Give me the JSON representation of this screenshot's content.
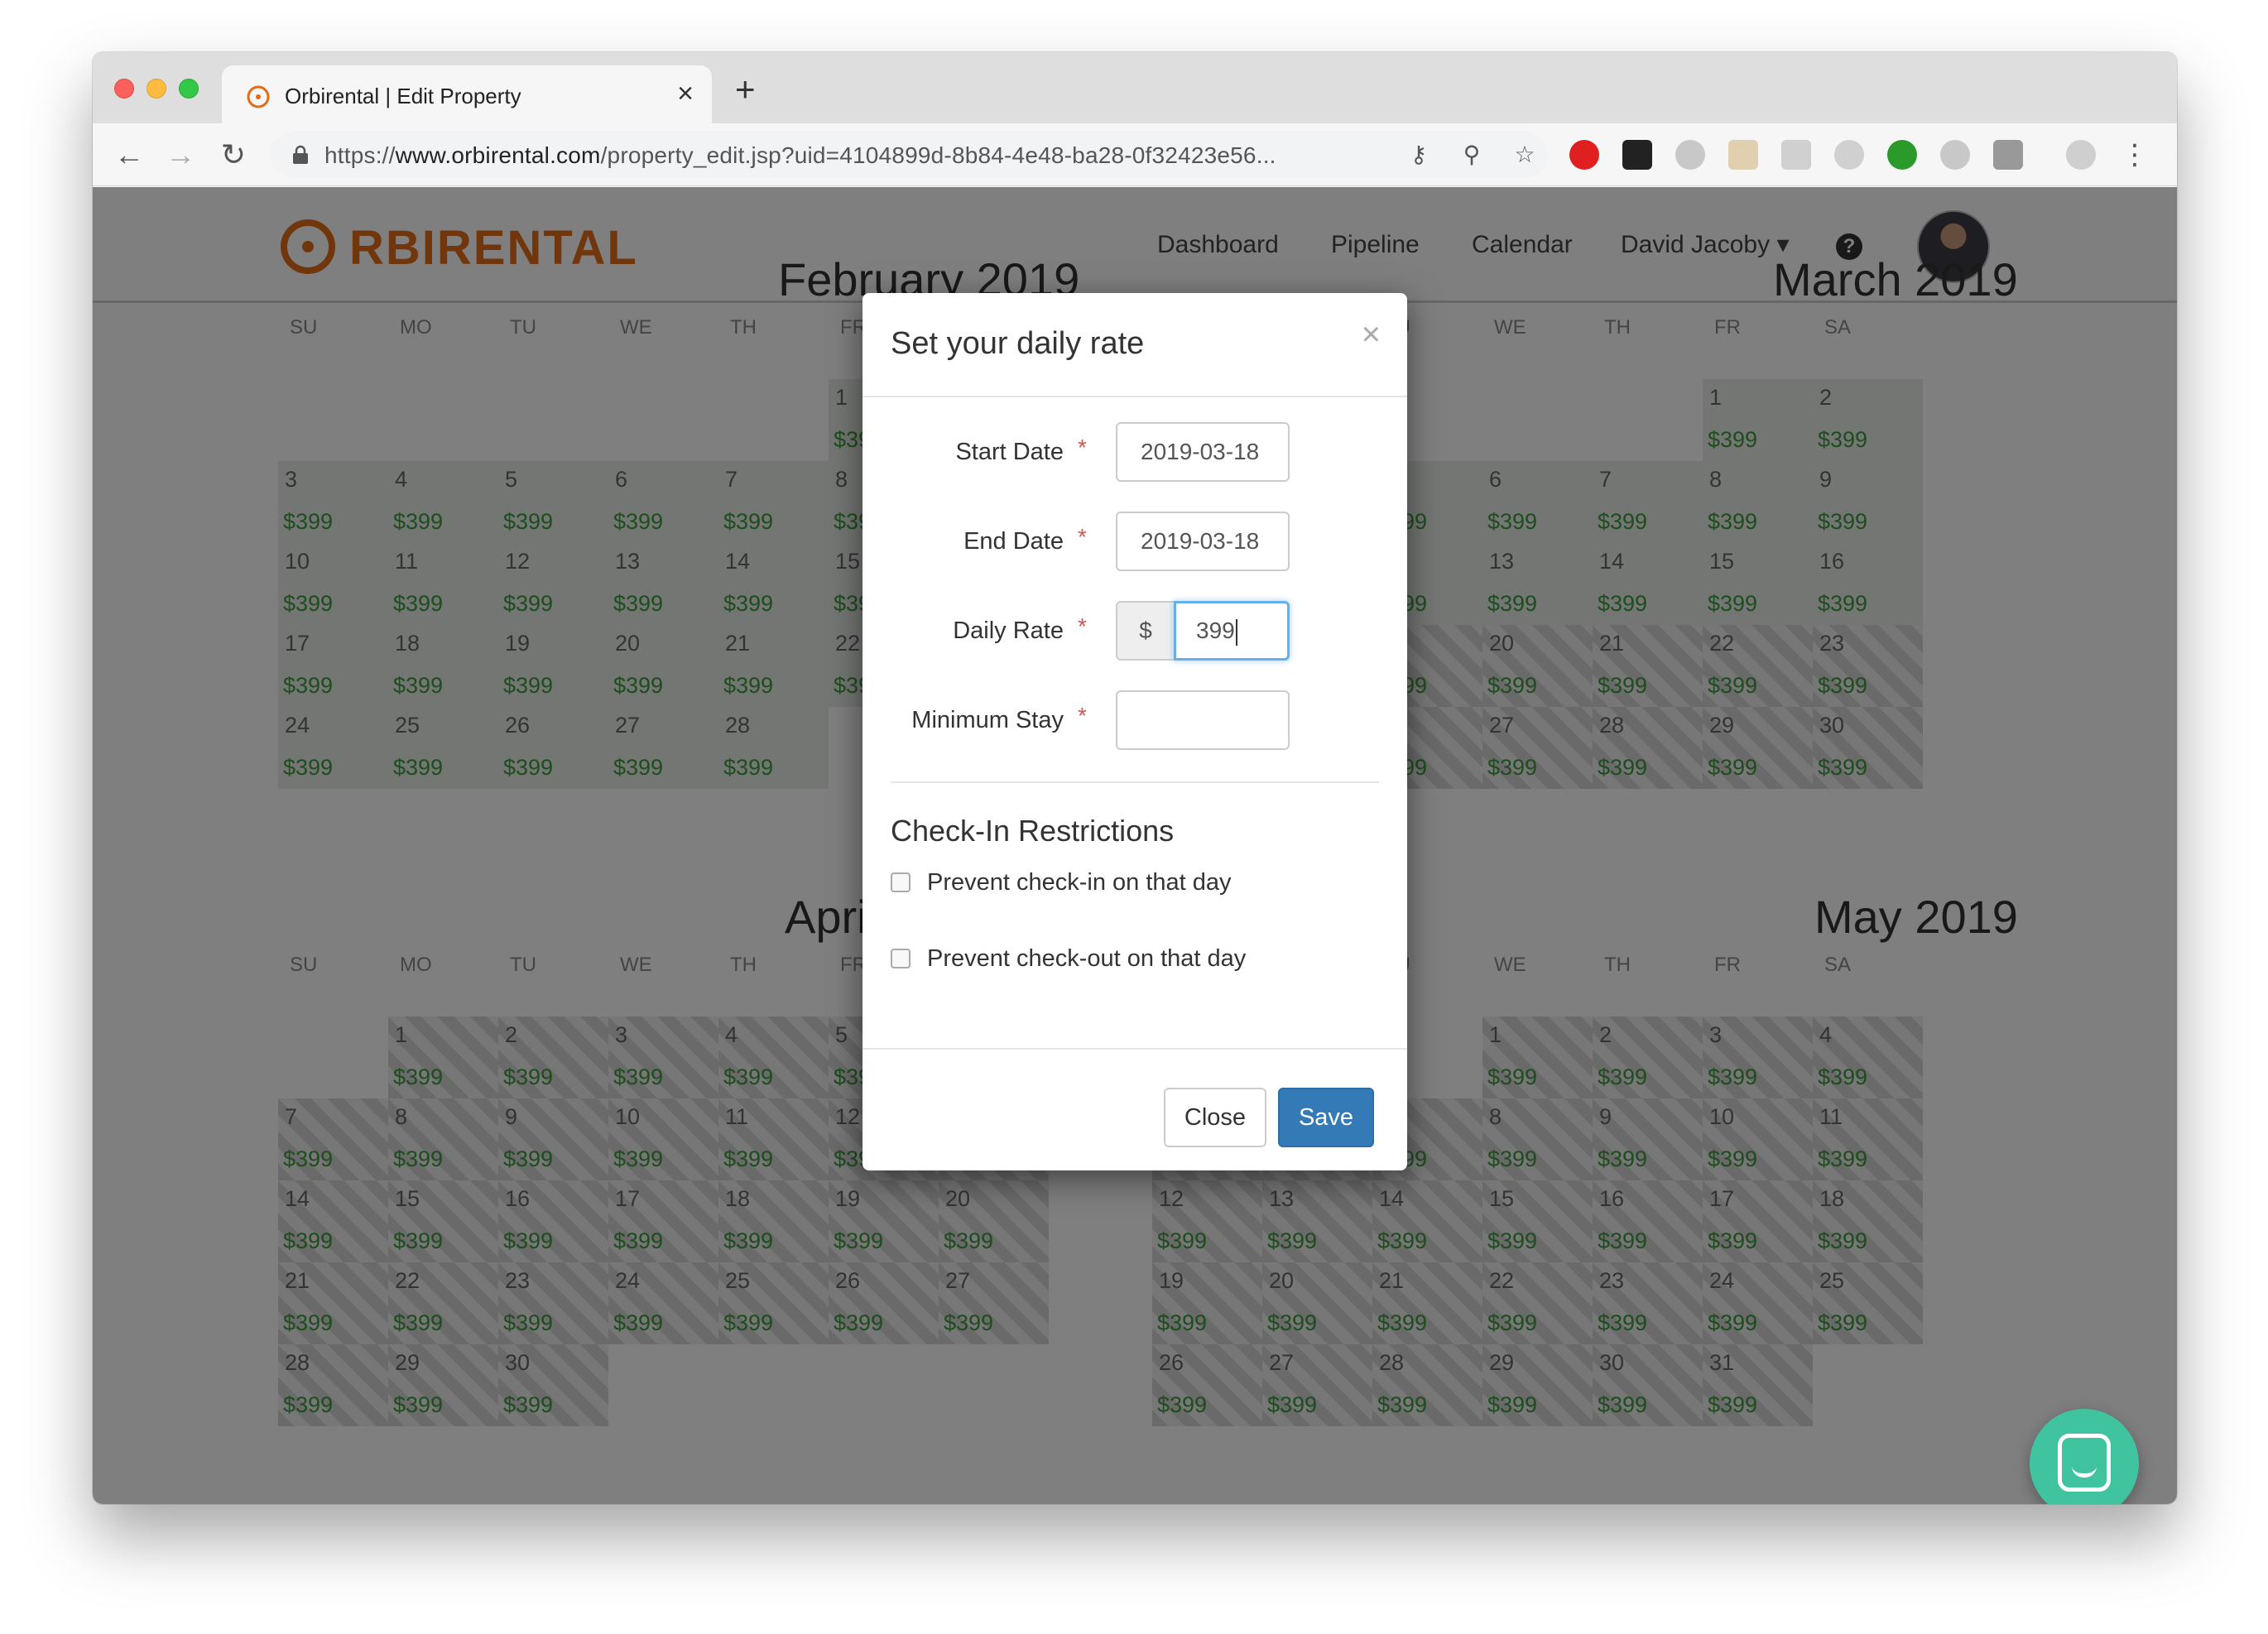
{
  "browser": {
    "tab_title": "Orbirental | Edit Property",
    "tab_close": "×",
    "new_tab": "+",
    "url_scheme": "https://",
    "url_host": "www.orbirental.com",
    "url_path": "/property_edit.jsp?uid=4104899d-8b84-4e48-ba28-0f32423e56..."
  },
  "navbar": {
    "logo_text": "RBIRENTAL",
    "links": [
      "Dashboard",
      "Pipeline",
      "Calendar"
    ],
    "user": "David Jacoby"
  },
  "calendar": {
    "months": {
      "feb": "February 2019",
      "mar": "March 2019",
      "apr": "April 2019",
      "may": "May 2019"
    },
    "weekdays": [
      "SU",
      "MO",
      "TU",
      "WE",
      "TH",
      "FR",
      "SA"
    ],
    "price": "$399"
  },
  "modal": {
    "title": "Set your daily rate",
    "close_x": "×",
    "start_label": "Start Date",
    "start_value": "2019-03-18",
    "end_label": "End Date",
    "end_value": "2019-03-18",
    "rate_label": "Daily Rate",
    "rate_addon": "$",
    "rate_value": "399",
    "minstay_label": "Minimum Stay",
    "minstay_value": "",
    "required_mark": "*",
    "section_title": "Check-In Restrictions",
    "prevent_checkin": "Prevent check-in on that day",
    "prevent_checkout": "Prevent check-out on that day",
    "close_button": "Close",
    "save_button": "Save"
  },
  "colors": {
    "brand": "#e36c17",
    "price": "#3c9a3c",
    "primary_button": "#337ab7",
    "chat": "#40c4a0"
  }
}
